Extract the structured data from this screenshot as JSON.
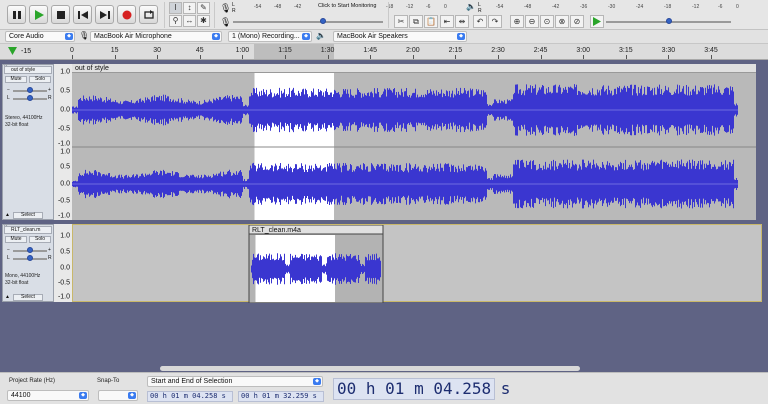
{
  "toolbar": {
    "transport": [
      "pause",
      "play",
      "stop",
      "skip-start",
      "skip-end",
      "record",
      "loop"
    ],
    "meter_click_label": "Click to Start Monitoring",
    "record_meter_ticks": [
      "-54",
      "-48",
      "-42",
      "-18",
      "-12",
      "-6",
      "0"
    ],
    "play_meter_ticks": [
      "-54",
      "-48",
      "-42",
      "-36",
      "-30",
      "-24",
      "-18",
      "-12",
      "-6",
      "0"
    ],
    "record_meter_letters": [
      "L",
      "R"
    ],
    "play_meter_letters": [
      "L",
      "R"
    ],
    "record_volume": 0.6,
    "play_volume": 0.85,
    "playback_speed": 0.5
  },
  "devicebar": {
    "host": "Core Audio",
    "mic": "MacBook Air Microphone",
    "channels": "1 (Mono) Recording...",
    "speaker": "MacBook Air Speakers"
  },
  "timeline": {
    "start_label": "-15",
    "ticks": [
      "0",
      "15",
      "30",
      "45",
      "1:00",
      "1:15",
      "1:30",
      "1:45",
      "2:00",
      "2:15",
      "2:30",
      "2:45",
      "3:00",
      "3:15",
      "3:30",
      "3:45"
    ],
    "selection_start_s": 64.258,
    "selection_end_s": 92.259
  },
  "tracks": [
    {
      "name": "out of style",
      "clip": "out of style",
      "mute": "Mute",
      "solo": "Solo",
      "info1": "Stereo, 44100Hz",
      "info2": "32-bit float",
      "select": "Select",
      "pan_letters": [
        "L",
        "R"
      ],
      "ruler": [
        "1.0",
        "0.5",
        "0.0",
        "-0.5",
        "-1.0",
        "1.0",
        "0.5",
        "0.0",
        "-0.5",
        "-1.0"
      ]
    },
    {
      "name": "RLT_clean.m",
      "clip": "RLT_clean.m4a",
      "mute": "Mute",
      "solo": "Solo",
      "info1": "Mono, 44100Hz",
      "info2": "32-bit float",
      "select": "Select",
      "pan_letters": [
        "L",
        "R"
      ],
      "ruler": [
        "1.0",
        "0.5",
        "0.0",
        "-0.5",
        "-1.0"
      ]
    }
  ],
  "selectionbar": {
    "rate_label": "Project Rate (Hz)",
    "snap_label": "Snap-To",
    "rate_value": "44100",
    "mode": "Start and End of Selection",
    "start": "00 h 01 m 04.258 s",
    "end": "00 h 01 m 32.259 s",
    "position": "00 h 01 m 04.258 s"
  },
  "colors": {
    "wave": "#3a36d0",
    "wave_light": "#6f6ce0",
    "selection": "#ffffff",
    "background": "#5f6384"
  }
}
